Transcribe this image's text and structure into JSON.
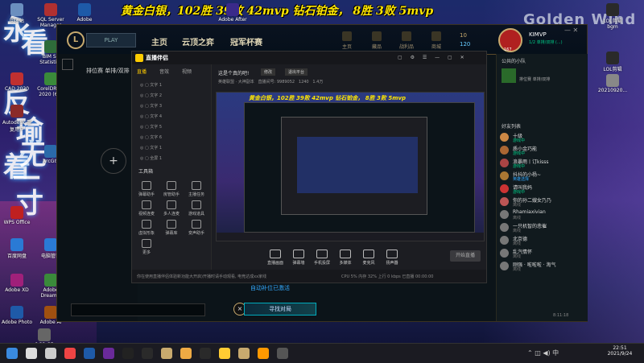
{
  "banner": "黄金白银，102胜 39败 42mvp 钻石铂金， 8胜 3败 5mvp",
  "wallpaper_text": "Golden Wind",
  "wallpaper_chars": [
    "永",
    "看",
    "反",
    "瑜",
    "着",
    "无",
    "一",
    "寸"
  ],
  "desktop_icons": [
    {
      "label": "回收站",
      "color": "#6b8fbf"
    },
    {
      "label": "SQL Server Manager",
      "color": "#b03030"
    },
    {
      "label": "Adobe",
      "color": "#1e5aa8"
    },
    {
      "label": "Adobe After",
      "color": "#3a2a8a"
    },
    {
      "label": "Patch",
      "color": "#444"
    },
    {
      "label": "Morrowmor",
      "color": "#555"
    },
    {
      "label": "LOL剪辑",
      "color": "#2a2a2a"
    },
    {
      "label": "LOL剪辑 bgm",
      "color": "#2a2a2a"
    },
    {
      "label": "20210920...",
      "color": "#888"
    },
    {
      "label": "BIM SF Statistics",
      "color": "#2e6c3a"
    },
    {
      "label": "CAD 2020",
      "color": "#c03030"
    },
    {
      "label": "CorelDRAW 2020 (64)",
      "color": "#3a8a3a"
    },
    {
      "label": "Autodesk 重复用户",
      "color": "#8a2a2a"
    },
    {
      "label": "ArcGIS",
      "color": "#2a6aaa"
    },
    {
      "label": "WPS Office",
      "color": "#c02020"
    },
    {
      "label": "百度网盘",
      "color": "#2a7ad5"
    },
    {
      "label": "电脑管家",
      "color": "#2a7ad5"
    },
    {
      "label": "Adobe XD",
      "color": "#a0207a"
    },
    {
      "label": "Adobe Dreamw",
      "color": "#3a8a3a"
    },
    {
      "label": "Adobe Ai",
      "color": "#a05010"
    },
    {
      "label": "Adobe Photo",
      "color": "#1e5aa8"
    },
    {
      "label": "6.33 GB",
      "color": "#666"
    }
  ],
  "lol": {
    "play_label": "PLAY",
    "nav": [
      "主页",
      "云顶之弈",
      "冠军杯赛"
    ],
    "top_icons": [
      "主页",
      "藏品",
      "战利品",
      "商城"
    ],
    "currency": {
      "be": "10",
      "rp": "120"
    },
    "profile": {
      "name": "KIMVP",
      "status": "1/2 单排/双排 (...)",
      "level": "167"
    },
    "lobby_title": "排位赛 单排/双排",
    "add_label": "+",
    "auto_fill": "自动补位已激活",
    "find_match": "寻找对局",
    "close": "×",
    "chat": {
      "group": "公共的小队",
      "role": "排位赛 单排/双排"
    },
    "friends_title": "好友列表",
    "friends": [
      {
        "name": "十级",
        "status": "游戏中",
        "color": "#c84"
      },
      {
        "name": "质小金巧能",
        "status": "游戏中",
        "color": "#a63"
      },
      {
        "name": "浪暴雨丨订kisss",
        "status": "游戏中",
        "color": "#a44"
      },
      {
        "name": "抖抖的小杨~",
        "status": "英雄选择",
        "color": "#a73"
      },
      {
        "name": "请叫我妈",
        "status": "游戏中",
        "color": "#c33"
      },
      {
        "name": "你的孙二嫂女乃乃",
        "status": "离线",
        "color": "#b55"
      },
      {
        "name": "Rhamiaxivian",
        "status": "离线",
        "color": "#777"
      },
      {
        "name": "一只机智的悲催",
        "status": "离线",
        "color": "#777"
      },
      {
        "name": "北京德",
        "status": "离线",
        "color": "#777"
      },
      {
        "name": "乱汽情怀",
        "status": "离线",
        "color": "#777"
      },
      {
        "name": "刚强 · 啦啦啦 · 淘气",
        "status": "离线",
        "color": "#777"
      }
    ],
    "time": "8:11:18"
  },
  "zhibo": {
    "title": "直播伴侣",
    "tabs": [
      "直播",
      "音效",
      "视频"
    ],
    "room_title": "这是个真的吧!",
    "btn_edit": "修改",
    "share": "退出平台",
    "stats": [
      "英雄联盟 · 大神副本",
      "直播间号: 9989052",
      "1240",
      "1.4万"
    ],
    "layers": [
      "文字 1",
      "文字 2",
      "文字 3",
      "文字 4",
      "文字 5",
      "文字 6",
      "文字 1",
      "全屏 1"
    ],
    "tools_title": "工具箱",
    "tools": [
      "弹幕助手",
      "房管助手",
      "主播任务",
      "视频连麦",
      "多人连麦",
      "游戏道具",
      "虚拟形象",
      "弹幕库",
      "变声助手",
      "更多"
    ],
    "controls": [
      "直播画面",
      "弹幕墙",
      "手机投屏",
      "多媒体",
      "麦克风",
      "扬声器"
    ],
    "start_live": "开始直播",
    "tip": "你在使用直播伴侣体验新功能大开启)开播时请手动观看, 电竞达成xx家线",
    "footer": [
      "CPU 5%",
      "内存 32%",
      "上行 0 kbps",
      "已直播 00:00:00",
      "帧率 30fps"
    ]
  },
  "clock": {
    "time": "22:51",
    "date": "2021/9/24"
  },
  "taskbar_icons": [
    "start",
    "search",
    "task-view",
    "chrome",
    "photoshop",
    "premiere",
    "capcut",
    "wechat",
    "lol-client",
    "streaming",
    "obs",
    "explorer",
    "lol",
    "app-a",
    "app-b"
  ]
}
